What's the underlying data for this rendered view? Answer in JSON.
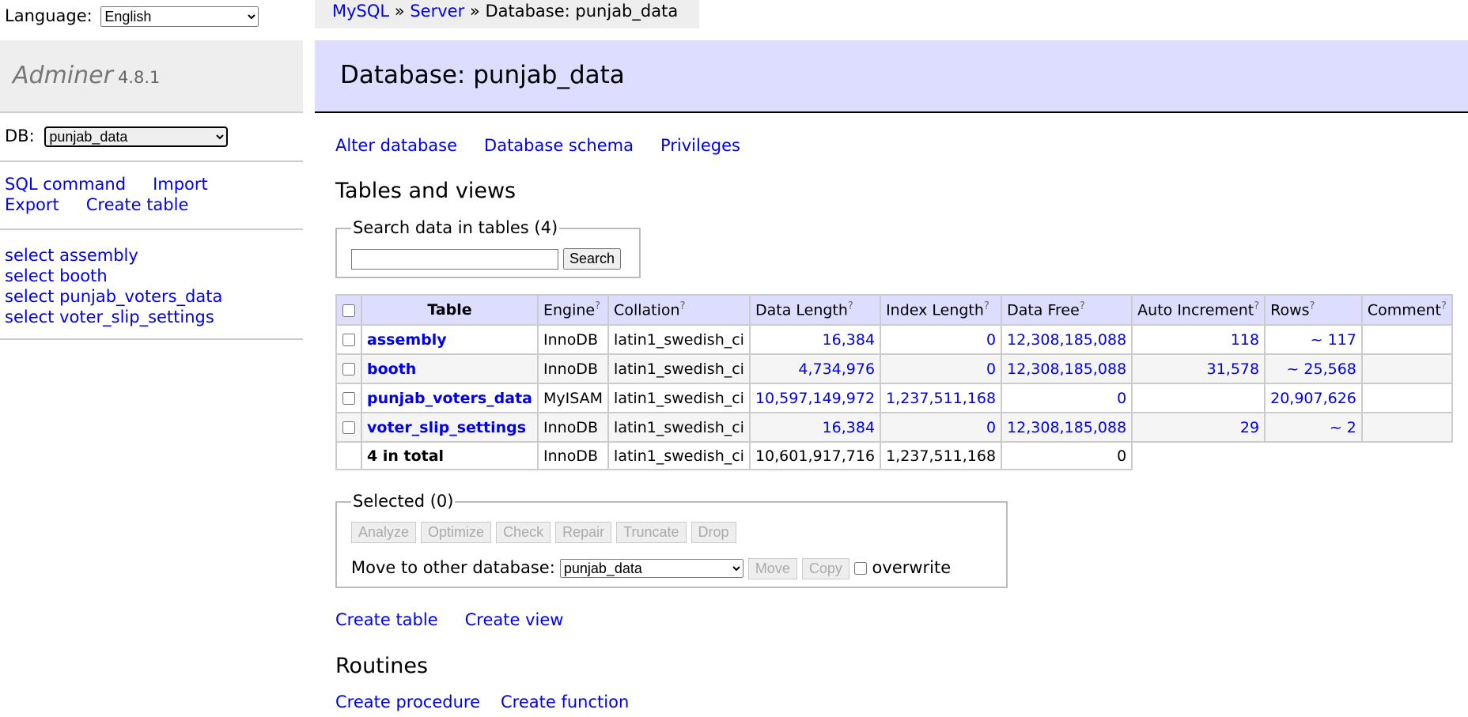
{
  "language": {
    "label": "Language:",
    "value": "English"
  },
  "brand": {
    "name": "Adminer",
    "version": "4.8.1"
  },
  "db_select": {
    "label": "DB:",
    "value": "punjab_data"
  },
  "sidebar_links": [
    "SQL command",
    "Import",
    "Export",
    "Create table"
  ],
  "sidebar_tables": [
    "select assembly",
    "select booth",
    "select punjab_voters_data",
    "select voter_slip_settings"
  ],
  "breadcrumb": {
    "mysql": "MySQL",
    "sep1": "»",
    "server": "Server",
    "sep2": "»",
    "current": "Database: punjab_data"
  },
  "page_title": "Database: punjab_data",
  "actions": [
    "Alter database",
    "Database schema",
    "Privileges"
  ],
  "tables_heading": "Tables and views",
  "search": {
    "legend": "Search data in tables (4)",
    "button": "Search",
    "value": ""
  },
  "table": {
    "headers": [
      "Table",
      "Engine",
      "Collation",
      "Data Length",
      "Index Length",
      "Data Free",
      "Auto Increment",
      "Rows",
      "Comment"
    ],
    "help_mark": "?",
    "rows": [
      {
        "name": "assembly",
        "engine": "InnoDB",
        "collation": "latin1_swedish_ci",
        "data_length": "16,384",
        "index_length": "0",
        "data_free": "12,308,185,088",
        "auto_increment": "118",
        "rows": "~ 117",
        "comment": ""
      },
      {
        "name": "booth",
        "engine": "InnoDB",
        "collation": "latin1_swedish_ci",
        "data_length": "4,734,976",
        "index_length": "0",
        "data_free": "12,308,185,088",
        "auto_increment": "31,578",
        "rows": "~ 25,568",
        "comment": ""
      },
      {
        "name": "punjab_voters_data",
        "engine": "MyISAM",
        "collation": "latin1_swedish_ci",
        "data_length": "10,597,149,972",
        "index_length": "1,237,511,168",
        "data_free": "0",
        "auto_increment": "",
        "rows": "20,907,626",
        "comment": ""
      },
      {
        "name": "voter_slip_settings",
        "engine": "InnoDB",
        "collation": "latin1_swedish_ci",
        "data_length": "16,384",
        "index_length": "0",
        "data_free": "12,308,185,088",
        "auto_increment": "29",
        "rows": "~ 2",
        "comment": ""
      }
    ],
    "total": {
      "label": "4 in total",
      "engine": "InnoDB",
      "collation": "latin1_swedish_ci",
      "data_length": "10,601,917,716",
      "index_length": "1,237,511,168",
      "data_free": "0"
    }
  },
  "selected": {
    "legend": "Selected (0)",
    "buttons": [
      "Analyze",
      "Optimize",
      "Check",
      "Repair",
      "Truncate",
      "Drop"
    ],
    "move_label": "Move to other database:",
    "move_db": "punjab_data",
    "move_button": "Move",
    "copy_button": "Copy",
    "overwrite_label": "overwrite"
  },
  "create_links": [
    "Create table",
    "Create view"
  ],
  "routines_heading": "Routines",
  "routine_links": [
    "Create procedure",
    "Create function"
  ]
}
